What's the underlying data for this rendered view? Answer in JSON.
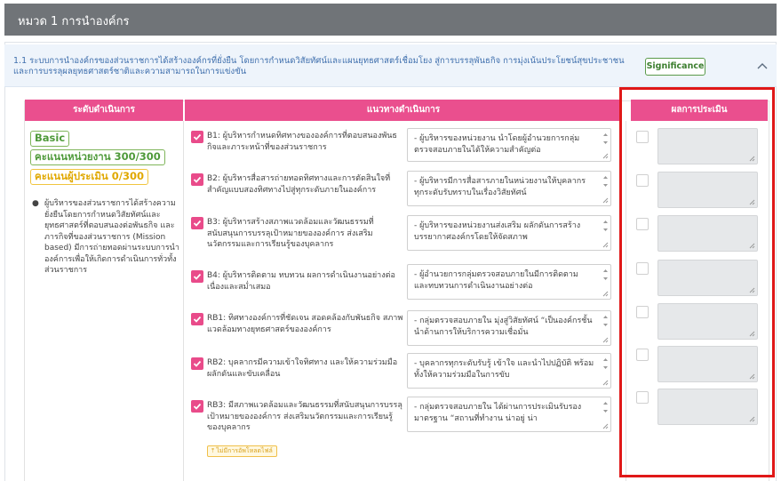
{
  "header": {
    "title": "หมวด 1 การนำองค์กร"
  },
  "section": {
    "text": "1.1 ระบบการนำองค์กรของส่วนราชการได้สร้างองค์กรที่ยั่งยืน โดยการกำหนดวิสัยทัศน์และแผนยุทธศาสตร์เชื่อมโยง สู่การบรรลุพันธกิจ การมุ่งเน้นประโยชน์สุขประชาชนและการบรรลุผลยุทธศาสตร์ชาติและความสามารถในการแข่งขัน",
    "significance_label": "Significance"
  },
  "table": {
    "headers": [
      "ระดับดำเนินการ",
      "แนวทางดำเนินการ",
      "ผลการประเมิน"
    ]
  },
  "level": {
    "name": "Basic",
    "agency_score": "คะแนนหน่วยงาน 300/300",
    "assessor_score": "คะแนนผู้ประเมิน 0/300",
    "description": "ผู้บริหารของส่วนราชการได้สร้างความยั่งยืนโดยการกำหนดวิสัยทัศน์และยุทธศาสตร์ที่ตอบสนองต่อพันธกิจ และภารกิจที่ของส่วนราชการ (Mission based) มีการถ่ายทอดผ่านระบบการนำองค์การเพื่อให้เกิดการดำเนินการทั่วทั้งส่วนราชการ"
  },
  "criteria": [
    {
      "label": "B1: ผู้บริหารกำหนดทิศทางขององค์การที่ตอบสนองพันธกิจและภาระหน้าที่ของส่วนราชการ",
      "note": "- ผู้บริหารของหน่วยงาน นำโดยผู้อำนวยการกลุ่มตรวจสอบภายในได้ให้ความสำคัญต่อ"
    },
    {
      "label": "B2: ผู้บริหารสื่อสารถ่ายทอดทิศทางและการตัดสินใจที่สำคัญแบบสองทิศทางไปสู่ทุกระดับภายในองค์การ",
      "note": "- ผู้บริหารมีการสื่อสารภายในหน่วยงานให้บุคลากรทุกระดับรับทราบในเรื่องวิสัยทัศน์"
    },
    {
      "label": "B3: ผู้บริหารสร้างสภาพแวดล้อมและวัฒนธรรมที่สนับสนุนการบรรลุเป้าหมายขององค์การ ส่งเสริมนวัตกรรมและการเรียนรู้ของบุคลากร",
      "note": "- ผู้บริหารของหน่วยงานส่งเสริม ผลักดันการสร้างบรรยากาศองค์กรโดยให้จัดสภาพ"
    },
    {
      "label": "B4: ผู้บริหารติดตาม ทบทวน ผลการดำเนินงานอย่างต่อเนื่องและสม่ำเสมอ",
      "note": "- ผู้อำนวยการกลุ่มตรวจสอบภายในมีการติดตาม และทบทวนการดำเนินงานอย่างต่อ"
    },
    {
      "label": "RB1: ทิศทางองค์การที่ชัดเจน สอดคล้องกับพันธกิจ สภาพแวดล้อมทางยุทธศาสตร์ขององค์การ",
      "note": "- กลุ่มตรวจสอบภายใน มุ่งสู่วิสัยทัศน์ “เป็นองค์กรชั้นนำด้านการให้บริการความเชื่อมั่น"
    },
    {
      "label": "RB2: บุคลากรมีความเข้าใจทิศทาง และให้ความร่วมมือผลักดันและขับเคลื่อน",
      "note": "- บุคลากรทุกระดับรับรู้ เข้าใจ และนำไปปฏิบัติ พร้อมทั้งให้ความร่วมมือในการขับ"
    },
    {
      "label": "RB3: มีสภาพแวดล้อมและวัฒนธรรมที่สนับสนุนการบรรลุเป้าหมายขององค์การ ส่งเสริมนวัตกรรมและการเรียนรู้ของบุคลากร",
      "note": "- กลุ่มตรวจสอบภายใน ได้ผ่านการประเมินรับรองมาตรฐาน “สถานที่ทำงาน น่าอยู่ น่า"
    }
  ],
  "upload_label": "ไม่มีการอัพโหลดไฟล์",
  "colors": {
    "table_header": "#ea4f8e",
    "checkbox": "#e94b8a",
    "highlight": "#e01818",
    "topbar": "#707478"
  }
}
